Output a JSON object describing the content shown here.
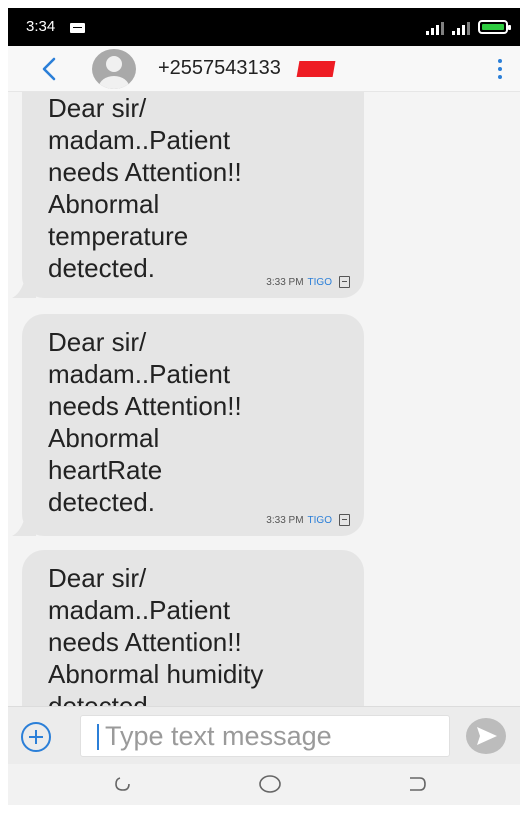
{
  "status_bar": {
    "time": "3:34",
    "accent_battery": "#2ecc40"
  },
  "header": {
    "contact_number": "+2557543133",
    "icons": [
      "back-chevron-icon",
      "avatar-icon",
      "more-vert-icon"
    ],
    "accent": "#2b7fd8"
  },
  "messages": [
    {
      "text": "Dear sir/\nmadam..Patient\nneeds Attention!!\nAbnormal\ntemperature\ndetected.",
      "time": "3:33 PM",
      "carrier": "TIGO"
    },
    {
      "text": "Dear sir/\nmadam..Patient\nneeds Attention!!\nAbnormal\nheartRate\ndetected.",
      "time": "3:33 PM",
      "carrier": "TIGO"
    },
    {
      "text": "Dear sir/\nmadam..Patient\nneeds Attention!!\nAbnormal humidity\ndetected.",
      "time": "",
      "carrier": ""
    }
  ],
  "input": {
    "placeholder": "Type text message"
  },
  "nav": {
    "icons": [
      "back-nav-icon",
      "home-nav-icon",
      "recents-nav-icon"
    ]
  }
}
